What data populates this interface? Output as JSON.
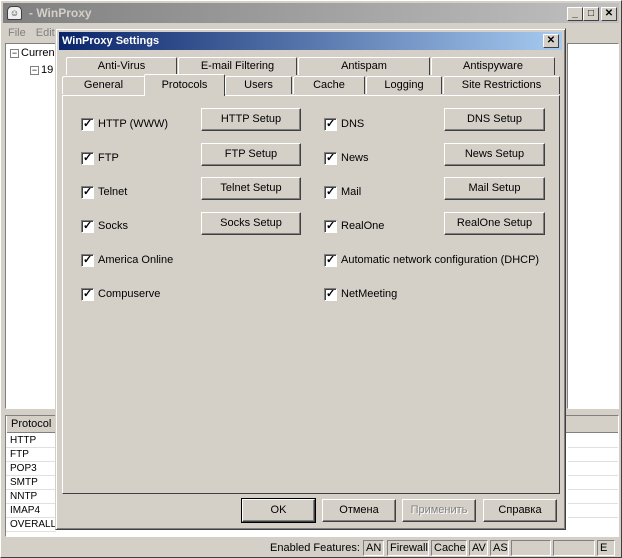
{
  "main": {
    "title": "- WinProxy",
    "icon": "app-icon",
    "menu": [
      "File",
      "Edit"
    ],
    "tree": [
      "Curren",
      "19"
    ],
    "grid": {
      "header": "Protocol",
      "rows": [
        "HTTP",
        "FTP",
        "POP3",
        "SMTP",
        "NNTP",
        "IMAP4",
        "OVERALL"
      ]
    },
    "status": {
      "label": "Enabled Features:",
      "items": [
        "AN",
        "Firewall",
        "Cache",
        "AV",
        "AS",
        "",
        "",
        "E"
      ]
    }
  },
  "dialog": {
    "title": "WinProxy Settings",
    "tabs_row1": [
      "Anti-Virus",
      "E-mail Filtering",
      "Antispam",
      "Antispyware"
    ],
    "tabs_row2": [
      "General",
      "Protocols",
      "Users",
      "Cache",
      "Logging",
      "Site Restrictions"
    ],
    "active_tab": "Protocols",
    "left_checks": [
      {
        "label": "HTTP (WWW)",
        "checked": true
      },
      {
        "label": "FTP",
        "checked": true
      },
      {
        "label": "Telnet",
        "checked": true
      },
      {
        "label": "Socks",
        "checked": true
      },
      {
        "label": "America Online",
        "checked": true
      },
      {
        "label": "Compuserve",
        "checked": true
      }
    ],
    "left_buttons": [
      "HTTP Setup",
      "FTP Setup",
      "Telnet Setup",
      "Socks Setup"
    ],
    "right_checks": [
      {
        "label": "DNS",
        "checked": true
      },
      {
        "label": "News",
        "checked": true
      },
      {
        "label": "Mail",
        "checked": true
      },
      {
        "label": "RealOne",
        "checked": true
      },
      {
        "label": "Automatic network configuration (DHCP)",
        "checked": true
      },
      {
        "label": "NetMeeting",
        "checked": true
      }
    ],
    "right_buttons": [
      "DNS Setup",
      "News Setup",
      "Mail Setup",
      "RealOne Setup"
    ],
    "footer": {
      "ok": "OK",
      "cancel": "Отмена",
      "apply": "Применить",
      "help": "Справка"
    },
    "check_glyph": "✓"
  }
}
